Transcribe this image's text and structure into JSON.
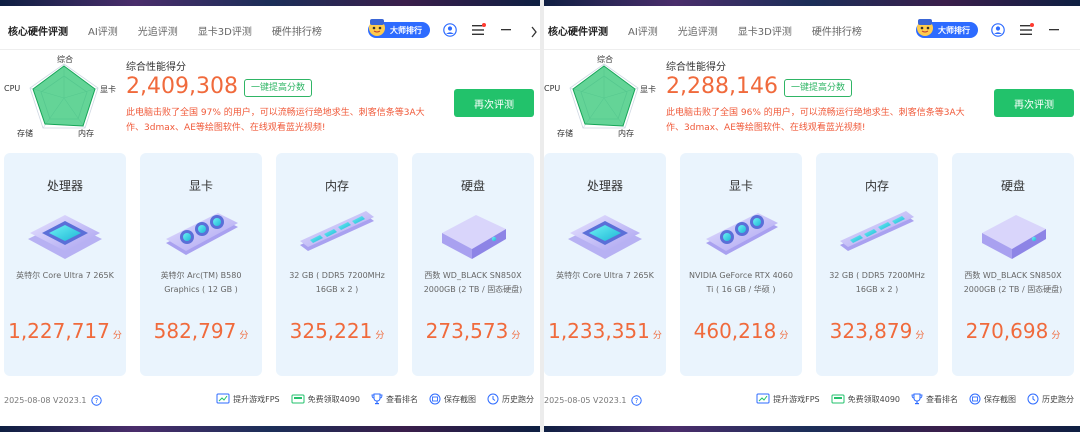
{
  "header": {
    "tabs": [
      "核心硬件评测",
      "AI评测",
      "光追评测",
      "显卡3D评测",
      "硬件排行榜"
    ],
    "master_badge": "大师排行"
  },
  "radar_labels": {
    "top": "综合",
    "right": "显卡",
    "bottom_right": "内存",
    "bottom_left": "存储",
    "left": "CPU"
  },
  "score_title": "综合性能得分",
  "boost_label": "一键提高分数",
  "retest_label": "再次评测",
  "card_titles": [
    "处理器",
    "显卡",
    "内存",
    "硬盘"
  ],
  "score_unit": "分",
  "footer_actions": [
    "提升游戏FPS",
    "免费领取4090",
    "查看排名",
    "保存截图",
    "历史跑分"
  ],
  "colors": {
    "accent_green": "#22c26b",
    "score_orange": "#f06a3c",
    "warn_red": "#f05a3a",
    "card_bg": "#eaf4fd",
    "badge_blue": "#2d6bff"
  },
  "panels": [
    {
      "total_score": "2,409,308",
      "description": "此电脑击败了全国 97% 的用户，可以流畅运行绝地求生、刺客信条等3A大作、3dmax、AE等绘图软件、在线观看蓝光视频!",
      "version": "2025-08-08 V2023.1",
      "radar": {
        "综合": 0.95,
        "显卡": 0.9,
        "内存": 0.95,
        "存储": 0.85,
        "CPU": 0.9
      },
      "cards": [
        {
          "desc": "英特尔 Core Ultra 7 265K",
          "score": "1,227,717"
        },
        {
          "desc": "英特尔 Arc(TM) B580 Graphics ( 12 GB )",
          "score": "582,797"
        },
        {
          "desc": "32 GB ( DDR5 7200MHz 16GB x 2 )",
          "score": "325,221"
        },
        {
          "desc": "西数 WD_BLACK SN850X 2000GB (2 TB / 固态硬盘)",
          "score": "273,573"
        }
      ]
    },
    {
      "total_score": "2,288,146",
      "description": "此电脑击败了全国 96% 的用户，可以流畅运行绝地求生、刺客信条等3A大作、3dmax、AE等绘图软件、在线观看蓝光视频!",
      "version": "2025-08-05 V2023.1",
      "radar": {
        "综合": 0.95,
        "显卡": 0.9,
        "内存": 0.95,
        "存储": 0.85,
        "CPU": 0.9
      },
      "cards": [
        {
          "desc": "英特尔 Core Ultra 7 265K",
          "score": "1,233,351"
        },
        {
          "desc": "NVIDIA GeForce RTX 4060 Ti ( 16 GB / 华硕 )",
          "score": "460,218"
        },
        {
          "desc": "32 GB ( DDR5 7200MHz 16GB x 2 )",
          "score": "323,879"
        },
        {
          "desc": "西数 WD_BLACK SN850X 2000GB (2 TB / 固态硬盘)",
          "score": "270,698"
        }
      ]
    }
  ]
}
